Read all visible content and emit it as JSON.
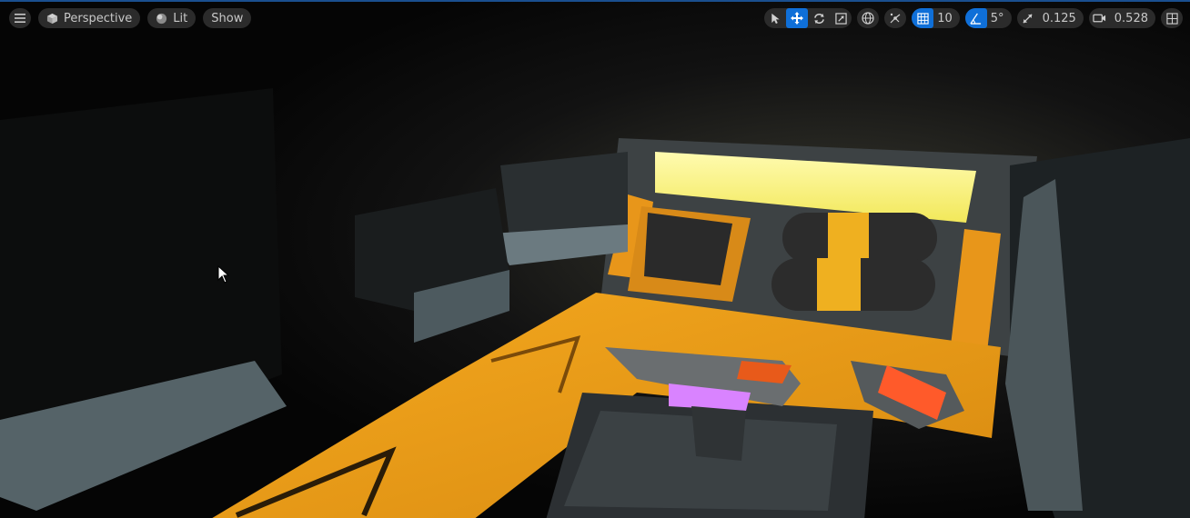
{
  "viewport": {
    "menu_icon": "hamburger-icon",
    "view_mode_label": "Perspective",
    "lighting_label": "Lit",
    "show_label": "Show",
    "grid_snap_value": "10",
    "rotation_snap_value": "5°",
    "scale_snap_value": "0.125",
    "camera_speed_value": "0.528"
  },
  "colors": {
    "accent": "#0f6fd8",
    "toolbar_bg": "#2b2b2b",
    "hazard_orange": "#f0a21c",
    "light_panel": "#f6f27a"
  }
}
